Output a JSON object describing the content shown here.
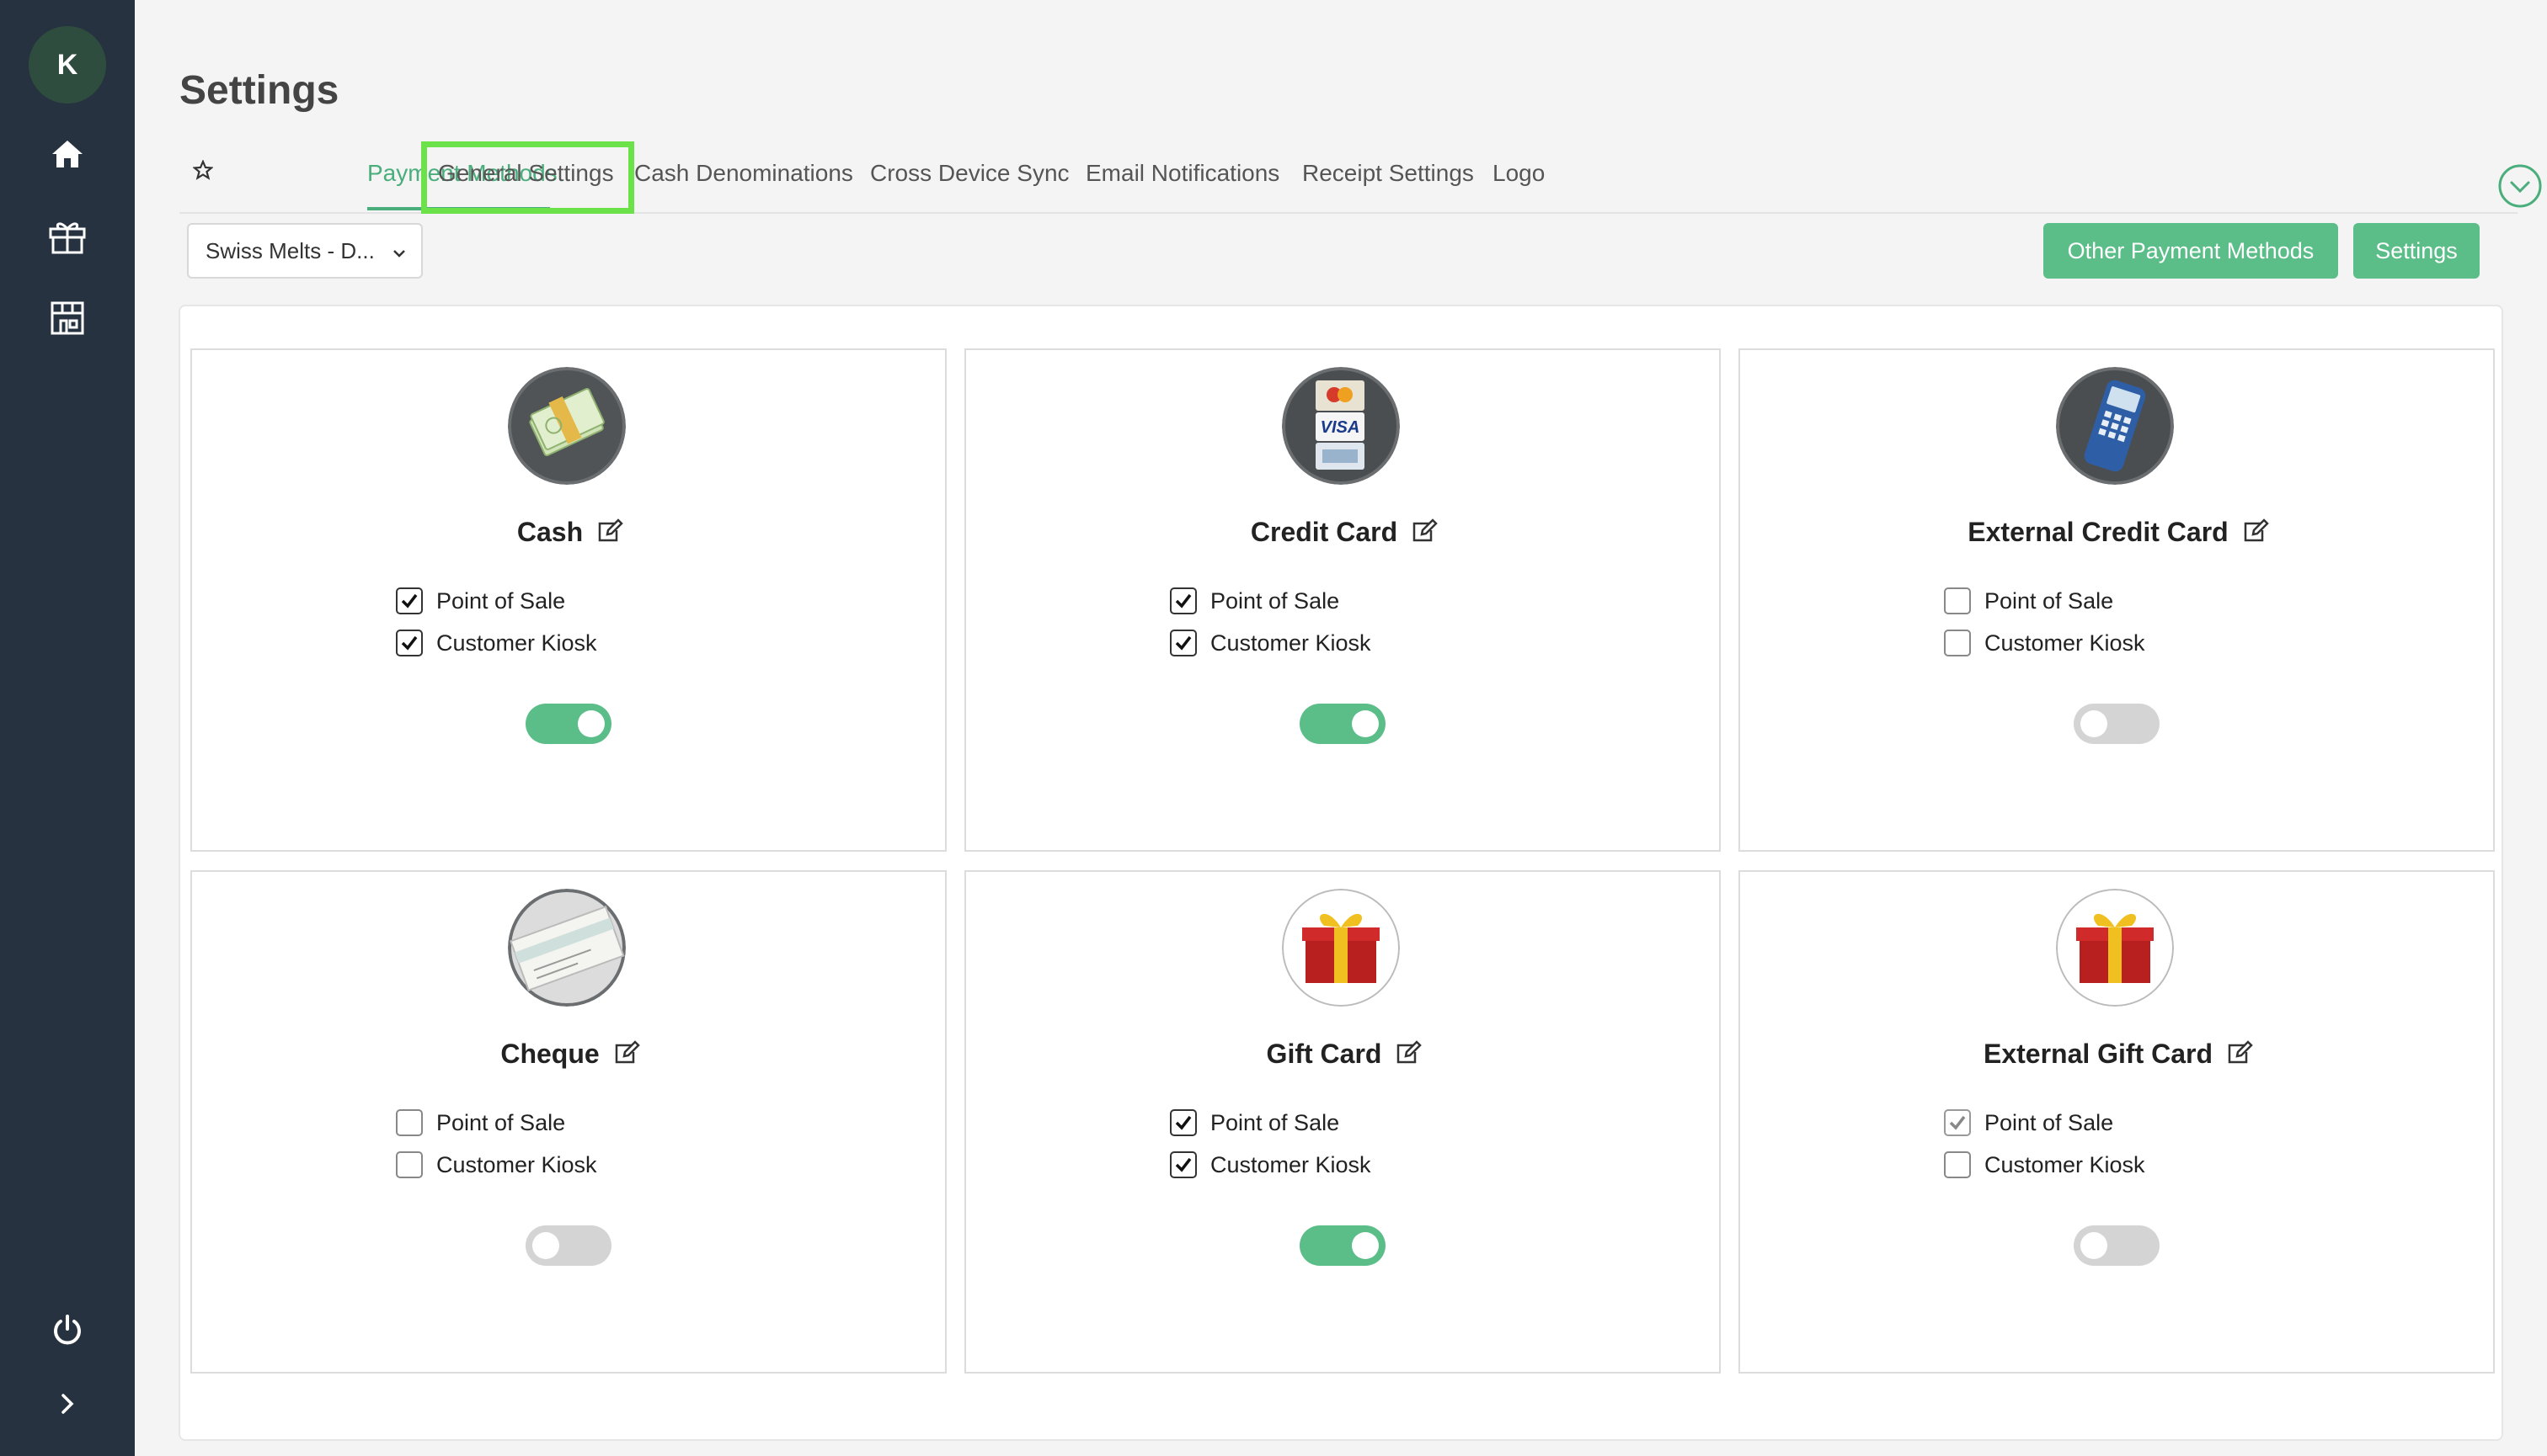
{
  "sidebar": {
    "avatar_initial": "K",
    "icons": [
      "home-icon",
      "gift-icon",
      "store-icon",
      "power-icon",
      "chevron-right-icon"
    ]
  },
  "page": {
    "title": "Settings"
  },
  "tabs": [
    {
      "label": "Payment Methods",
      "active": true
    },
    {
      "label": "General Settings",
      "highlighted": true
    },
    {
      "label": "Cash Denominations"
    },
    {
      "label": "Cross Device Sync"
    },
    {
      "label": "Email Notifications"
    },
    {
      "label": "Receipt Settings"
    },
    {
      "label": "Logo"
    }
  ],
  "location_select": {
    "value": "Swiss Melts - D..."
  },
  "buttons": {
    "other_payment_methods": "Other Payment Methods",
    "settings": "Settings"
  },
  "labels": {
    "point_of_sale": "Point of Sale",
    "customer_kiosk": "Customer Kiosk"
  },
  "colors": {
    "accent": "#5bbd88",
    "sidebar": "#263240",
    "highlight": "#6be24a"
  },
  "cards": [
    {
      "title": "Cash",
      "icon": "cash-icon",
      "point_of_sale": true,
      "customer_kiosk": true,
      "enabled": true
    },
    {
      "title": "Credit Card",
      "icon": "credit-card-icon",
      "point_of_sale": true,
      "customer_kiosk": true,
      "enabled": true
    },
    {
      "title": "External Credit Card",
      "icon": "card-terminal-icon",
      "point_of_sale": false,
      "customer_kiosk": false,
      "enabled": false
    },
    {
      "title": "Cheque",
      "icon": "cheque-icon",
      "point_of_sale": false,
      "customer_kiosk": false,
      "enabled": false
    },
    {
      "title": "Gift Card",
      "icon": "gift-box-icon",
      "point_of_sale": true,
      "customer_kiosk": true,
      "enabled": true
    },
    {
      "title": "External Gift Card",
      "icon": "gift-box-icon",
      "point_of_sale": true,
      "customer_kiosk": false,
      "enabled": false
    }
  ]
}
